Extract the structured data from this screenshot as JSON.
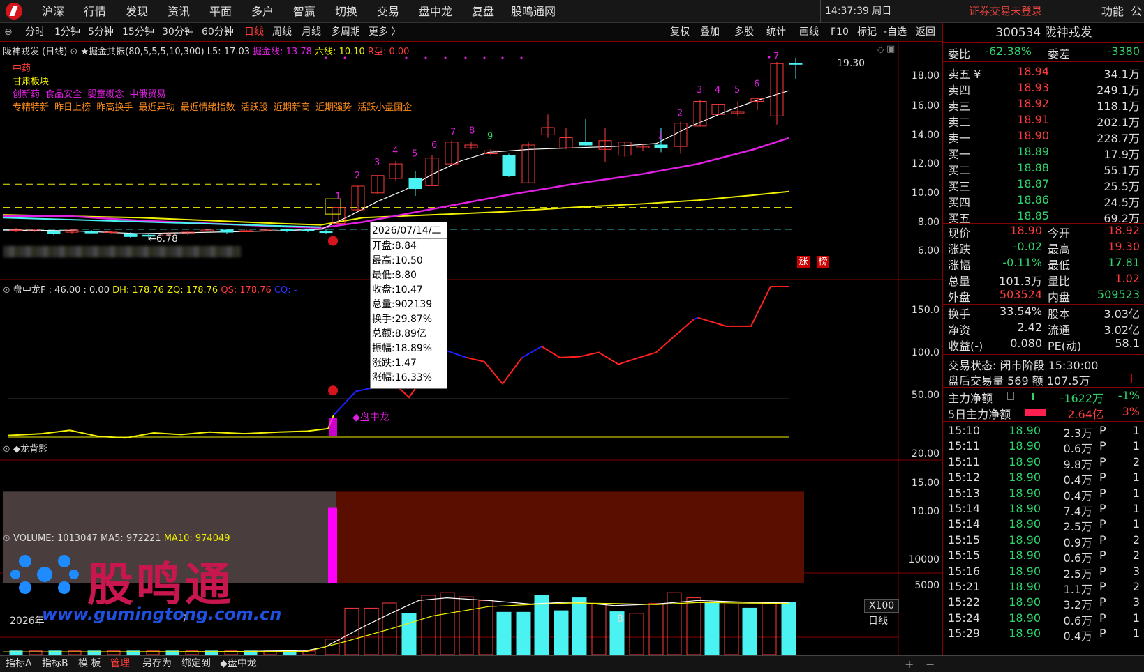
{
  "menubar": {
    "items": [
      "沪深",
      "行情",
      "发现",
      "资讯",
      "平面",
      "多户",
      "智赢",
      "切换",
      "交易",
      "盘中龙",
      "复盘",
      "股鸣通网"
    ],
    "clock": "14:37:39 周日",
    "login_status": "证券交易未登录",
    "func_label": "功能",
    "gong": "公"
  },
  "periods": [
    "分时",
    "1分钟",
    "5分钟",
    "15分钟",
    "30分钟",
    "60分钟",
    "日线",
    "周线",
    "月线",
    "多周期",
    "更多 〉"
  ],
  "active_period": "日线",
  "tools": [
    "复权",
    "叠加",
    "多股",
    "统计",
    "画线",
    "F10",
    "标记",
    "-自选",
    "返回"
  ],
  "chart": {
    "title_name": "陇神戎发 (日线)",
    "indicator": "★掘金共振(80,5,5,5,10,300)",
    "l5": "L5: 17.03",
    "jueji": "掘金线: 13.78",
    "liuxian": "六线: 10.10",
    "rtype": "R型: 0.00",
    "tags": {
      "line1": "中药",
      "line2": "甘肃板块",
      "line3": [
        "创新药",
        "食品安全",
        "婴童概念",
        "中俄贸易"
      ],
      "line4": [
        "专精特新",
        "昨日上榜",
        "昨高换手",
        "最近异动",
        "最近情绪指数",
        "活跃股",
        "近期新高",
        "近期强势",
        "活跃小盘国企"
      ]
    },
    "price_axis": [
      "18.00",
      "16.00",
      "14.00",
      "12.00",
      "10.00",
      "8.00",
      "6.00"
    ],
    "high_label": "19.30",
    "low_label": "6.78",
    "zhang": "涨",
    "bang": "榜",
    "count_labels": [
      "1",
      "2",
      "3",
      "4",
      "5",
      "6",
      "7",
      "8",
      "9",
      "1",
      "2",
      "3",
      "4",
      "5",
      "6",
      "7"
    ]
  },
  "tooltip": {
    "date": "2026/07/14/二",
    "items": [
      "开盘:8.84",
      "最高:10.50",
      "最低:8.80",
      "收盘:10.47",
      "总量:902139",
      "换手:29.87%",
      "总额:8.89亿",
      "振幅:18.89%",
      "涨跌:1.47",
      "涨幅:16.33%"
    ]
  },
  "pane2": {
    "title": "盘中龙F : 46.00 : 0.00",
    "dh": "DH: 178.76",
    "zq": "ZQ: 178.76",
    "qs": "QS: 178.76",
    "cq": "CQ: -",
    "axis": [
      "150.0",
      "100.0",
      "50.00"
    ],
    "marker": "◆盘中龙"
  },
  "pane3": {
    "title": "◆龙背影",
    "axis": [
      "20.00",
      "15.00",
      "10.00"
    ]
  },
  "pane4": {
    "title": "VOLUME: 1013047",
    "ma5": "MA5: 972221",
    "ma10": "MA10: 974049",
    "axis": [
      "10000",
      "5000"
    ],
    "unit": "X100",
    "year_label": "2026年",
    "month7": "7",
    "month8": "8",
    "period_label": "日线"
  },
  "watermark": {
    "text": "股鸣通",
    "url": "www.gumingtong.com.cn"
  },
  "quote": {
    "code_name": "300534 陇神戎发",
    "weibi_label": "委比",
    "weibi": "-62.38%",
    "weicha_label": "委差",
    "weicha": "-3380",
    "asks": [
      {
        "label": "卖五 ¥",
        "price": "18.94",
        "vol": "34.1万"
      },
      {
        "label": "卖四",
        "price": "18.93",
        "vol": "249.1万"
      },
      {
        "label": "卖三",
        "price": "18.92",
        "vol": "118.1万"
      },
      {
        "label": "卖二",
        "price": "18.91",
        "vol": "202.1万"
      },
      {
        "label": "卖一",
        "price": "18.90",
        "vol": "228.7万"
      }
    ],
    "bids": [
      {
        "label": "买一",
        "price": "18.89",
        "vol": "17.9万"
      },
      {
        "label": "买二",
        "price": "18.88",
        "vol": "55.1万"
      },
      {
        "label": "买三",
        "price": "18.87",
        "vol": "25.5万"
      },
      {
        "label": "买四",
        "price": "18.86",
        "vol": "24.5万"
      },
      {
        "label": "买五",
        "price": "18.85",
        "vol": "69.2万"
      }
    ],
    "stats1": [
      {
        "l1": "现价",
        "v1": "18.90",
        "c1": "red",
        "l2": "今开",
        "v2": "18.92",
        "c2": "red"
      },
      {
        "l1": "涨跌",
        "v1": "-0.02",
        "c1": "grn",
        "l2": "最高",
        "v2": "19.30",
        "c2": "red"
      },
      {
        "l1": "涨幅",
        "v1": "-0.11%",
        "c1": "grn",
        "l2": "最低",
        "v2": "17.81",
        "c2": "grn"
      },
      {
        "l1": "总量",
        "v1": "101.3万",
        "c1": "wht",
        "l2": "量比",
        "v2": "1.02",
        "c2": "red"
      },
      {
        "l1": "外盘",
        "v1": "503524",
        "c1": "red",
        "l2": "内盘",
        "v2": "509523",
        "c2": "grn"
      }
    ],
    "stats2": [
      {
        "l1": "换手",
        "v1": "33.54%",
        "l2": "股本",
        "v2": "3.03亿"
      },
      {
        "l1": "净资",
        "v1": "2.42",
        "l2": "流通",
        "v2": "3.02亿"
      },
      {
        "l1": "收益(-)",
        "v1": "0.080",
        "l2": "PE(动)",
        "v2": "58.1"
      }
    ],
    "trade_status": "交易状态: 闭市阶段 15:30:00",
    "after_hours": "盘后交易量 569 额 107.5万",
    "main_net_label": "主力净额",
    "main_net_val": "-1622万",
    "main_net_pct": "-1%",
    "main5_label": "5日主力净额",
    "main5_val": "2.64亿",
    "main5_pct": "3%",
    "ticks": [
      {
        "t": "15:10",
        "p": "18.90",
        "v": "2.3万",
        "f": "P",
        "n": "1"
      },
      {
        "t": "15:11",
        "p": "18.90",
        "v": "0.6万",
        "f": "P",
        "n": "1"
      },
      {
        "t": "15:11",
        "p": "18.90",
        "v": "9.8万",
        "f": "P",
        "n": "2"
      },
      {
        "t": "15:12",
        "p": "18.90",
        "v": "0.4万",
        "f": "P",
        "n": "1"
      },
      {
        "t": "15:13",
        "p": "18.90",
        "v": "0.4万",
        "f": "P",
        "n": "1"
      },
      {
        "t": "15:14",
        "p": "18.90",
        "v": "7.4万",
        "f": "P",
        "n": "1"
      },
      {
        "t": "15:14",
        "p": "18.90",
        "v": "2.5万",
        "f": "P",
        "n": "1"
      },
      {
        "t": "15:15",
        "p": "18.90",
        "v": "0.9万",
        "f": "P",
        "n": "2"
      },
      {
        "t": "15:15",
        "p": "18.90",
        "v": "0.6万",
        "f": "P",
        "n": "2"
      },
      {
        "t": "15:16",
        "p": "18.90",
        "v": "2.5万",
        "f": "P",
        "n": "3"
      },
      {
        "t": "15:21",
        "p": "18.90",
        "v": "1.1万",
        "f": "P",
        "n": "2"
      },
      {
        "t": "15:22",
        "p": "18.90",
        "v": "3.2万",
        "f": "P",
        "n": "3"
      },
      {
        "t": "15:24",
        "p": "18.90",
        "v": "0.6万",
        "f": "P",
        "n": "1"
      },
      {
        "t": "15:29",
        "p": "18.90",
        "v": "0.4万",
        "f": "P",
        "n": "1"
      }
    ]
  },
  "bottombar": {
    "tabs": [
      "指标A",
      "指标B",
      "模 板",
      "管理",
      "另存为",
      "绑定到",
      "◆盘中龙"
    ],
    "plus": "+",
    "minus": "−"
  },
  "colors": {
    "up": "#ff3b3b",
    "down": "#4af2f2",
    "ma_white": "#ffffff",
    "ma_magenta": "#e020e0",
    "ma_yellow": "#f0f000",
    "accent_red": "#d5141b"
  }
}
